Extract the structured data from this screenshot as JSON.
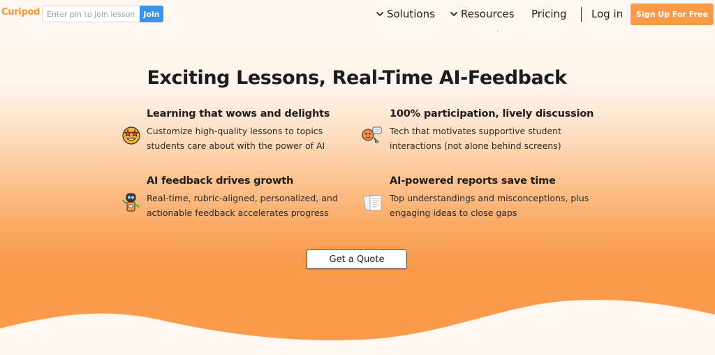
{
  "header": {
    "logo_text": "Curipod",
    "pin_placeholder": "Enter pin to join lesson",
    "join_label": "Join",
    "nav": {
      "solutions": "Solutions",
      "resources": "Resources",
      "pricing": "Pricing",
      "login": "Log in"
    },
    "signup_label": "Sign Up For Free"
  },
  "headline": "Exciting Lessons, Real-Time AI-Feedback",
  "features": [
    {
      "title": "Learning that wows and delights",
      "desc": "Customize high-quality lessons to topics students care about with the power of AI",
      "icon": "star-eyes-emoji-icon"
    },
    {
      "title": "100% participation, lively discussion",
      "desc": "Tech that motivates supportive student interactions (not alone behind screens)",
      "icon": "chatting-characters-icon"
    },
    {
      "title": "AI feedback drives growth",
      "desc": "Real-time, rubric-aligned, personalized, and actionable feedback accelerates progress",
      "icon": "robot-icon"
    },
    {
      "title": "AI-powered reports save time",
      "desc": "Top understandings and misconceptions, plus engaging ideas to close gaps",
      "icon": "report-documents-icon"
    }
  ],
  "cta_label": "Get a Quote",
  "colors": {
    "brand_orange": "#fa9a49",
    "join_blue": "#3b93e6",
    "text_dark": "#1f1f1f"
  }
}
